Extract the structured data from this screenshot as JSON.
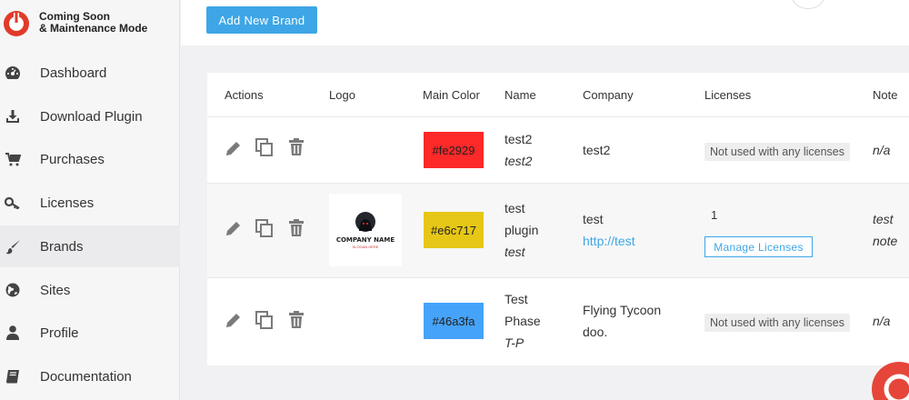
{
  "app": {
    "title_line1": "Coming Soon",
    "title_line2": "& Maintenance Mode",
    "logo_icon": "wrench-shield-icon",
    "brand_color": "#e23a2a"
  },
  "sidebar": {
    "items": [
      {
        "label": "Dashboard",
        "icon": "dashboard-icon",
        "active": false
      },
      {
        "label": "Download Plugin",
        "icon": "download-icon",
        "active": false
      },
      {
        "label": "Purchases",
        "icon": "cart-icon",
        "active": false
      },
      {
        "label": "Licenses",
        "icon": "key-icon",
        "active": false
      },
      {
        "label": "Brands",
        "icon": "paintbrush-icon",
        "active": true
      },
      {
        "label": "Sites",
        "icon": "globe-icon",
        "active": false
      },
      {
        "label": "Profile",
        "icon": "user-icon",
        "active": false
      },
      {
        "label": "Documentation",
        "icon": "book-icon",
        "active": false
      }
    ]
  },
  "toolbar": {
    "add_label": "Add New Brand",
    "accent": "#3ea6e6"
  },
  "table": {
    "headers": {
      "actions": "Actions",
      "logo": "Logo",
      "main_color": "Main Color",
      "name": "Name",
      "company": "Company",
      "licenses": "Licenses",
      "note": "Note"
    },
    "rows": [
      {
        "color": "#fe2929",
        "color_label": "#fe2929",
        "name_line1": "test2",
        "name_line2": "",
        "slug": "test2",
        "company_line1": "test2",
        "company_line2": "",
        "license_text": "Not used with any licenses",
        "license_count": "",
        "manage_label": "",
        "note_line1": "n/a",
        "note_line2": "",
        "has_logo": false
      },
      {
        "color": "#e6c717",
        "color_label": "#e6c717",
        "name_line1": "test",
        "name_line2": "plugin",
        "slug": "test",
        "company_line1": "test",
        "company_line2": "http://test",
        "license_text": "",
        "license_count": "1",
        "manage_label": "Manage Licenses",
        "note_line1": "test",
        "note_line2": "note",
        "has_logo": true,
        "logo_name": "COMPANY NAME",
        "logo_tagline": "SLOGAN HERE"
      },
      {
        "color": "#46a3fa",
        "color_label": "#46a3fa",
        "name_line1": "Test",
        "name_line2": "Phase",
        "slug": "T-P",
        "company_line1": "Flying Tycoon",
        "company_line2": "doo.",
        "license_text": "Not used with any licenses",
        "license_count": "",
        "manage_label": "",
        "note_line1": "n/a",
        "note_line2": "",
        "has_logo": false
      }
    ]
  }
}
